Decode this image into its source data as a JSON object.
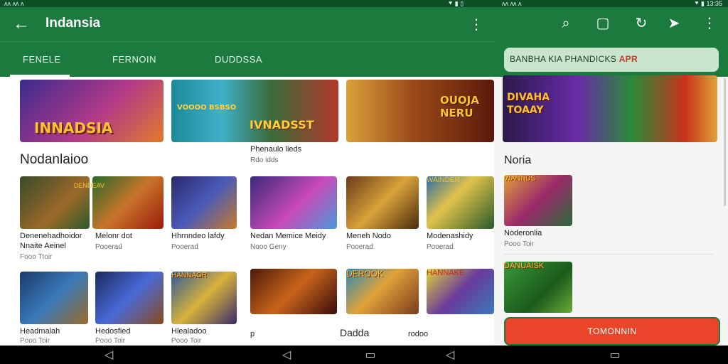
{
  "status": {
    "left": "ᴧᴧ ᴧᴧ ᴧ",
    "mid_right": "⯆ ▮ ▯",
    "mid": "ᴧᴧ ᴧᴧ ᴧ",
    "right": "⯆ ▮ 13:35"
  },
  "appbar": {
    "back_icon": "arrow-back-icon",
    "title": "Indansia"
  },
  "tabs": [
    {
      "label": "FENELE"
    },
    {
      "label": "FERNOIN"
    },
    {
      "label": "DUDDSSA"
    }
  ],
  "banners": [
    {
      "text": "INNADSIA",
      "bg": "#4b2e7a"
    },
    {
      "text": "IVNADSST",
      "sub": "VOOOO BSBSO",
      "caption": "Phenaulo lieds",
      "caption2": "Rdo idds",
      "bg": "#1d7b8f"
    },
    {
      "text": "OUOJA NERU",
      "bg": "#b7631c"
    }
  ],
  "section_title": "Nodanlaioo",
  "row1": [
    {
      "name": "Denenehadhoidor",
      "sub": "Nnaite Aeinel",
      "meta": "Fooo Ttoir",
      "color": "#7a3a1a"
    },
    {
      "name": "Melonr dot",
      "sub": "Pooerad",
      "meta": "",
      "color": "#9b2a16"
    },
    {
      "name": "Hhrnndeo lafdy",
      "sub": "Pooerad",
      "meta": "",
      "color": "#2b3f8c"
    },
    {
      "name": "Nedan Memice Meidy",
      "sub": "Nooo Geny",
      "meta": "",
      "color": "#8b3f9c"
    },
    {
      "name": "Meneh Nodo",
      "sub": "Pooerad",
      "meta": "",
      "color": "#6b3a14"
    },
    {
      "name": "Modenashidy",
      "sub": "Pooerad",
      "meta": "",
      "color": "#2d7a3a"
    }
  ],
  "row2": [
    {
      "name": "Headmalah",
      "sub": "Pooo Toir",
      "color": "#1e4b7a"
    },
    {
      "name": "Hedosfied",
      "sub": "Pooo Toir",
      "color": "#3a2a6b"
    },
    {
      "name": "Hlealadoo",
      "sub": "Pooo Toir",
      "color": "#1a5b8c"
    },
    {
      "name": "p",
      "sub": "",
      "color": "#7a2a14"
    },
    {
      "name": "Dadda",
      "sub": "",
      "color": "#c2552a"
    },
    {
      "name": "rodoo",
      "sub": "",
      "color": "#7a5e1a"
    }
  ],
  "row1_badges": [
    "DENDEAV",
    "",
    "",
    "",
    "",
    "WAINDER"
  ],
  "row2_badges": [
    "",
    "",
    "HANNAGR",
    "",
    "DEROOK",
    "HANNAKE"
  ],
  "right": {
    "icons": [
      "search-icon",
      "square-icon",
      "refresh-icon",
      "share-icon",
      "more-icon"
    ],
    "search_text": "BANBHA KIA PHANDICKS",
    "search_tag": "APR",
    "banner_text": "DIVAHA TOAAY",
    "section_title": "Noria",
    "cards": [
      {
        "name": "Noderonlia",
        "sub": "Pooo Toir",
        "badge": "WANNDS",
        "color": "#2a7a4a"
      },
      {
        "name": "",
        "sub": "",
        "badge": "DANUAISK",
        "color": "#3a8a2a"
      }
    ],
    "cta": "TOMONNIN"
  },
  "nav": [
    "◁",
    "▭",
    "◁",
    "▭",
    "◁",
    "▭"
  ],
  "colors": {
    "primary": "#1b7a3e",
    "accent": "#e8452b"
  }
}
